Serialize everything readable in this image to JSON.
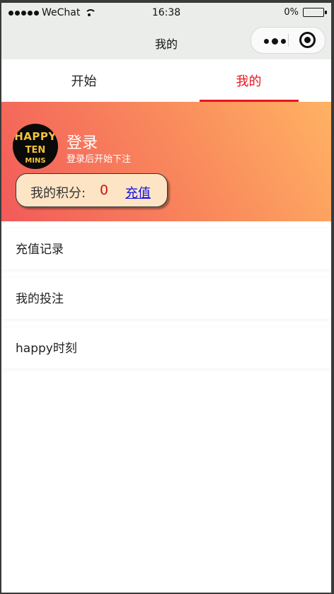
{
  "status_bar": {
    "carrier": "WeChat",
    "time": "16:38",
    "battery": "0%"
  },
  "navbar": {
    "title": "我的"
  },
  "tabs": [
    {
      "label": "开始",
      "active": false
    },
    {
      "label": "我的",
      "active": true
    }
  ],
  "profile": {
    "avatar_text": [
      "HAPPY",
      "TEN",
      "MINS"
    ],
    "login_title": "登录",
    "login_subtitle": "登录后开始下注",
    "points_label": "我的积分:",
    "points_value": "0",
    "recharge_label": "充值"
  },
  "menu": [
    {
      "label": "充值记录"
    },
    {
      "label": "我的投注"
    },
    {
      "label": "happy时刻"
    }
  ],
  "colors": {
    "accent": "#e8141e",
    "gradient_start": "#f25a5a",
    "gradient_end": "#ffb264",
    "points_bg": "#fde4c4",
    "link": "#1010ee"
  }
}
